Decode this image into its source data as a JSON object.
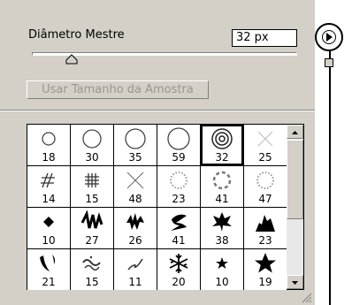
{
  "header": {
    "master_diameter_label": "Diâmetro Mestre",
    "master_diameter_value": "32 px"
  },
  "slider": {
    "value": 32
  },
  "sample_button_label": "Usar Tamanho da Amostra",
  "brushes": [
    {
      "size": "18",
      "icon": "hard-round-brush-icon"
    },
    {
      "size": "30",
      "icon": "hard-round-brush-icon"
    },
    {
      "size": "35",
      "icon": "hard-round-brush-icon"
    },
    {
      "size": "59",
      "icon": "hard-round-brush-icon"
    },
    {
      "size": "32",
      "icon": "concentric-rings-brush-icon",
      "selected": true
    },
    {
      "size": "25",
      "icon": "cross-brush-icon"
    },
    {
      "size": "14",
      "icon": "hatch-brush-icon"
    },
    {
      "size": "15",
      "icon": "grid-brush-icon"
    },
    {
      "size": "48",
      "icon": "x-brush-icon"
    },
    {
      "size": "23",
      "icon": "dotted-ring-brush-icon"
    },
    {
      "size": "41",
      "icon": "dashed-ring-brush-icon"
    },
    {
      "size": "47",
      "icon": "dotted-ring-brush-icon"
    },
    {
      "size": "10",
      "icon": "diamond-brush-icon"
    },
    {
      "size": "27",
      "icon": "zigzag-brush-icon"
    },
    {
      "size": "26",
      "icon": "grass-brush-icon"
    },
    {
      "size": "41",
      "icon": "swirl-brush-icon"
    },
    {
      "size": "38",
      "icon": "maple-brush-icon"
    },
    {
      "size": "23",
      "icon": "ramp-brush-icon"
    },
    {
      "size": "21",
      "icon": "stroke-brush-icon"
    },
    {
      "size": "15",
      "icon": "wave-brush-icon"
    },
    {
      "size": "11",
      "icon": "scribble-brush-icon"
    },
    {
      "size": "20",
      "icon": "snowflake-brush-icon"
    },
    {
      "size": "10",
      "icon": "small-star-brush-icon"
    },
    {
      "size": "19",
      "icon": "star-brush-icon"
    }
  ]
}
